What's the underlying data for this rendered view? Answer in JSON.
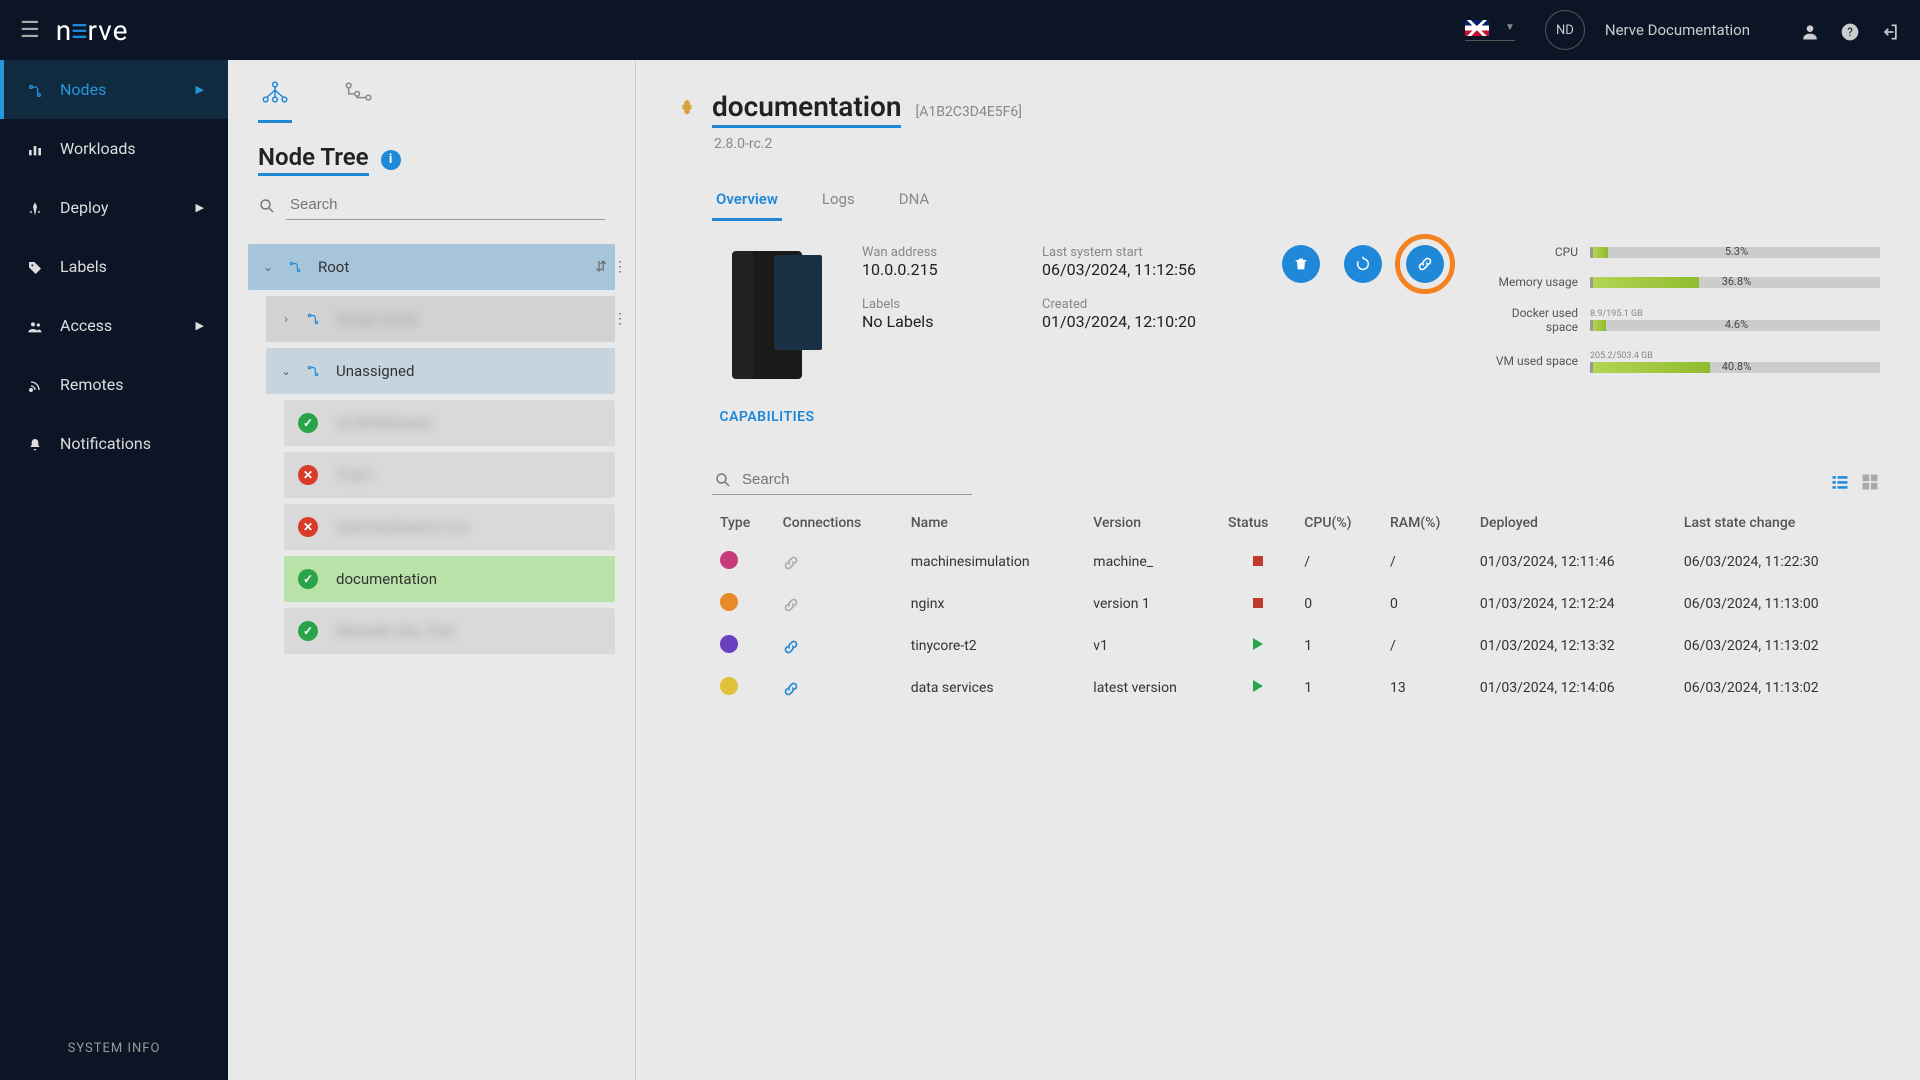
{
  "topbar": {
    "avatar_initials": "ND",
    "doc_link_label": "Nerve Documentation"
  },
  "sidebar": {
    "items": [
      {
        "label": "Nodes",
        "active": true,
        "expandable": true
      },
      {
        "label": "Workloads"
      },
      {
        "label": "Deploy",
        "expandable": true
      },
      {
        "label": "Labels"
      },
      {
        "label": "Access",
        "expandable": true
      },
      {
        "label": "Remotes"
      },
      {
        "label": "Notifications"
      }
    ],
    "system_info": "SYSTEM INFO"
  },
  "tree": {
    "title": "Node Tree",
    "search_placeholder": "Search",
    "root_label": "Root",
    "blurred_group": "Group name",
    "unassigned_label": "Unassigned",
    "leaves": [
      {
        "status": "green",
        "label": "Af NVIDIAauto",
        "blurred": true
      },
      {
        "status": "red",
        "label": "True1",
        "blurred": true
      },
      {
        "status": "red",
        "label": "Auto-bookworm run",
        "blurred": true
      },
      {
        "status": "green",
        "label": "documentation",
        "blurred": false,
        "selected": true
      },
      {
        "status": "green",
        "label": "Remade site_Test",
        "blurred": true
      }
    ]
  },
  "node": {
    "name": "documentation",
    "id": "[A1B2C3D4E5F6]",
    "version": "2.8.0-rc.2",
    "capabilities_label": "CAPABILITIES",
    "tabs": [
      {
        "label": "Overview",
        "active": true
      },
      {
        "label": "Logs"
      },
      {
        "label": "DNA"
      }
    ],
    "info": {
      "wan_label": "Wan address",
      "wan_value": "10.0.0.215",
      "start_label": "Last system start",
      "start_value": "06/03/2024, 11:12:56",
      "labels_label": "Labels",
      "labels_value": "No Labels",
      "created_label": "Created",
      "created_value": "01/03/2024, 12:10:20"
    },
    "metrics": [
      {
        "label": "CPU",
        "sub": "",
        "pct": 5.3,
        "text": "5.3%"
      },
      {
        "label": "Memory usage",
        "sub": "",
        "pct": 36.8,
        "text": "36.8%"
      },
      {
        "label": "Docker used space",
        "sub": "8.9/195.1 GB",
        "pct": 4.6,
        "text": "4.6%"
      },
      {
        "label": "VM used space",
        "sub": "205.2/503.4 GB",
        "pct": 40.8,
        "text": "40.8%"
      }
    ]
  },
  "workloads": {
    "search_placeholder": "Search",
    "columns": [
      "Type",
      "Connections",
      "Name",
      "Version",
      "Status",
      "CPU(%)",
      "RAM(%)",
      "Deployed",
      "Last state change"
    ],
    "rows": [
      {
        "type": "pink",
        "conn": "off",
        "name": "machinesimulation",
        "version": "machine_",
        "status": "red",
        "cpu": "/",
        "ram": "/",
        "deployed": "01/03/2024, 12:11:46",
        "changed": "06/03/2024, 11:22:30"
      },
      {
        "type": "orange",
        "conn": "off",
        "name": "nginx",
        "version": "version 1",
        "status": "red",
        "cpu": "0",
        "ram": "0",
        "deployed": "01/03/2024, 12:12:24",
        "changed": "06/03/2024, 11:13:00"
      },
      {
        "type": "purple",
        "conn": "on",
        "name": "tinycore-t2",
        "version": "v1",
        "status": "green",
        "cpu": "1",
        "ram": "/",
        "deployed": "01/03/2024, 12:13:32",
        "changed": "06/03/2024, 11:13:02"
      },
      {
        "type": "yellow",
        "conn": "on",
        "name": "data services",
        "version": "latest version",
        "status": "green",
        "cpu": "1",
        "ram": "13",
        "deployed": "01/03/2024, 12:14:06",
        "changed": "06/03/2024, 11:13:02"
      }
    ]
  }
}
